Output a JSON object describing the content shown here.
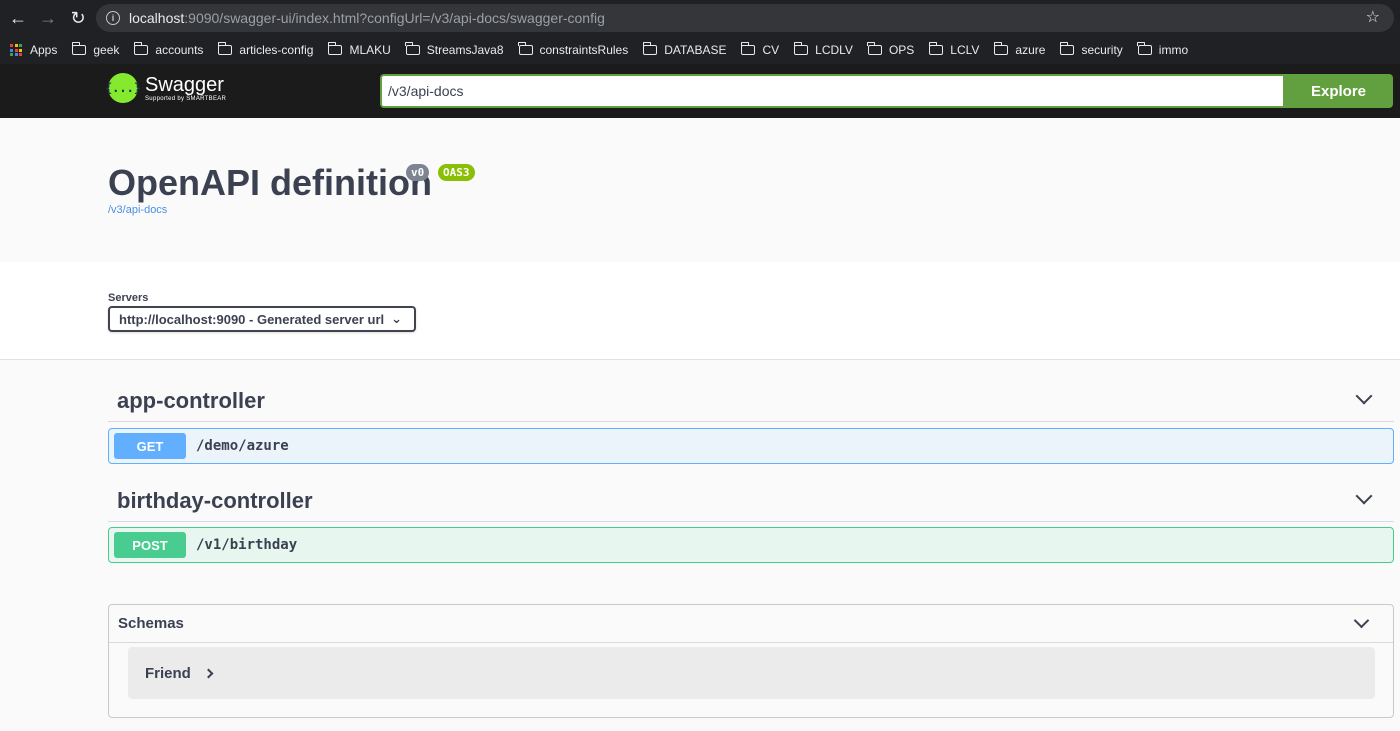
{
  "browser": {
    "url_host": "localhost",
    "url_rest": ":9090/swagger-ui/index.html?configUrl=/v3/api-docs/swagger-config",
    "bookmarks": [
      "Apps",
      "geek",
      "accounts",
      "articles-config",
      "MLAKU",
      "StreamsJava8",
      "constraintsRules",
      "DATABASE",
      "CV",
      "LCDLV",
      "OPS",
      "LCLV",
      "azure",
      "security",
      "immo"
    ]
  },
  "topbar": {
    "logo_name": "Swagger",
    "logo_sub": "Supported by SMARTBEAR",
    "logo_glyph": "{...}",
    "explore_value": "/v3/api-docs",
    "explore_label": "Explore"
  },
  "info": {
    "title": "OpenAPI definition",
    "version_badge": "v0",
    "oas_badge": "OAS3",
    "link": "/v3/api-docs"
  },
  "servers": {
    "label": "Servers",
    "selected": "http://localhost:9090 - Generated server url"
  },
  "tags": [
    {
      "name": "app-controller",
      "operations": [
        {
          "method": "GET",
          "path": "/demo/azure"
        }
      ]
    },
    {
      "name": "birthday-controller",
      "operations": [
        {
          "method": "POST",
          "path": "/v1/birthday"
        }
      ]
    }
  ],
  "schemas": {
    "title": "Schemas",
    "models": [
      "Friend"
    ]
  },
  "colors": {
    "get": "#61affe",
    "post": "#49cc90",
    "explore": "#62a03f",
    "oas": "#89bf04"
  }
}
